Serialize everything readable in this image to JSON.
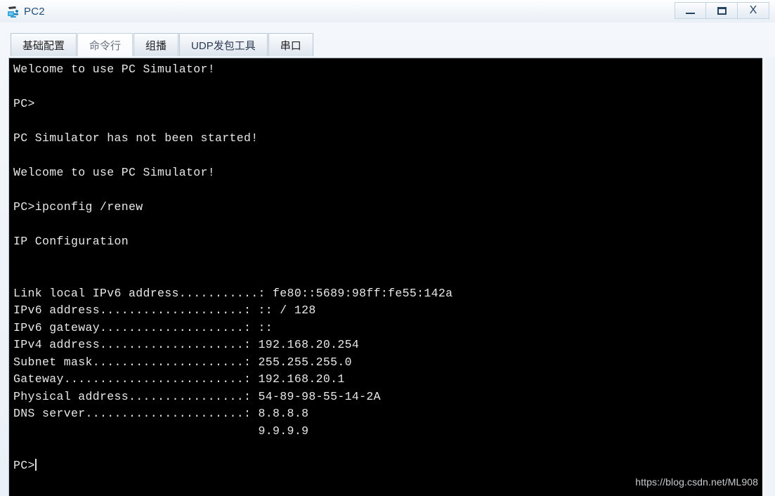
{
  "window": {
    "title": "PC2",
    "icon": "pc-device-icon",
    "controls": {
      "minimize": "—",
      "maximize": "□",
      "close": "X"
    }
  },
  "tabs": [
    {
      "label": "基础配置",
      "name": "tab-basic-config",
      "active": false
    },
    {
      "label": "命令行",
      "name": "tab-command-line",
      "active": true
    },
    {
      "label": "组播",
      "name": "tab-multicast",
      "active": false
    },
    {
      "label": "UDP发包工具",
      "name": "tab-udp-tool",
      "active": false
    },
    {
      "label": "串口",
      "name": "tab-serial-port",
      "active": false
    }
  ],
  "terminal": {
    "prompt": "PC>",
    "command": "ipconfig /renew",
    "lines": [
      "Welcome to use PC Simulator!",
      "",
      "PC>",
      "",
      "PC Simulator has not been started!",
      "",
      "Welcome to use PC Simulator!",
      "",
      "PC>ipconfig /renew",
      "",
      "IP Configuration",
      "",
      "",
      "Link local IPv6 address...........: fe80::5689:98ff:fe55:142a",
      "IPv6 address....................: :: / 128",
      "IPv6 gateway....................: ::",
      "IPv4 address....................: 192.168.20.254",
      "Subnet mask.....................: 255.255.255.0",
      "Gateway.........................: 192.168.20.1",
      "Physical address................: 54-89-98-55-14-2A",
      "DNS server......................: 8.8.8.8",
      "                                  9.9.9.9",
      "",
      "PC>"
    ],
    "ip_configuration_title": "IP Configuration",
    "fields": [
      {
        "label": "Link local IPv6 address",
        "value": "fe80::5689:98ff:fe55:142a"
      },
      {
        "label": "IPv6 address",
        "value": ":: / 128"
      },
      {
        "label": "IPv6 gateway",
        "value": "::"
      },
      {
        "label": "IPv4 address",
        "value": "192.168.20.254"
      },
      {
        "label": "Subnet mask",
        "value": "255.255.255.0"
      },
      {
        "label": "Gateway",
        "value": "192.168.20.1"
      },
      {
        "label": "Physical address",
        "value": "54-89-98-55-14-2A"
      },
      {
        "label": "DNS server",
        "value": "8.8.8.8"
      },
      {
        "label": "",
        "value": "9.9.9.9"
      }
    ]
  },
  "watermark": "https://blog.csdn.net/ML908",
  "colors": {
    "terminal_bg": "#000000",
    "terminal_fg": "#e8e8e8",
    "title_text": "#1f4e79",
    "window_chrome": "#eaf0f7",
    "tab_border": "#b8c4d0",
    "watermark": "#c9cccf"
  }
}
